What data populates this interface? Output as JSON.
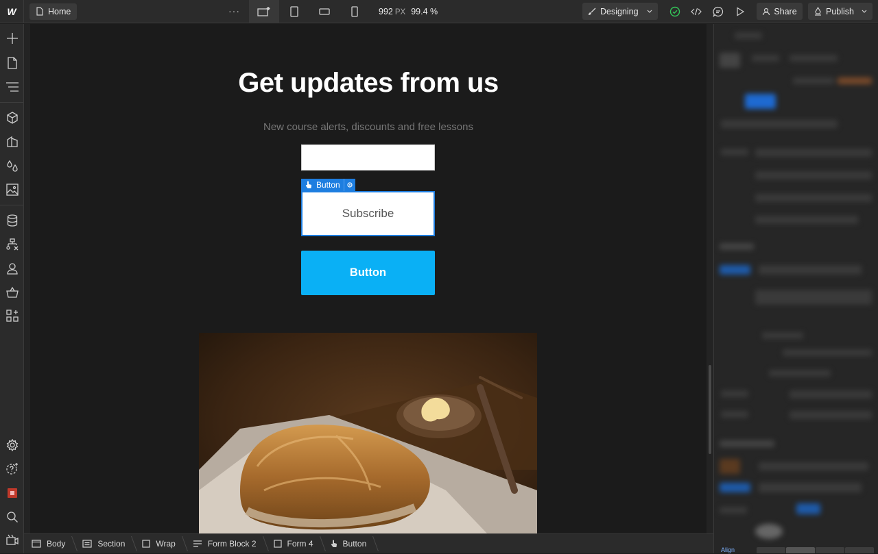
{
  "topbar": {
    "page_label": "Home",
    "more_label": "···",
    "width_value": "992",
    "width_unit": "PX",
    "zoom_value": "99.4 %",
    "mode_label": "Designing",
    "share_label": "Share",
    "publish_label": "Publish"
  },
  "canvas": {
    "heading": "Get updates from us",
    "subheading": "New course alerts, discounts and free lessons",
    "selected_tag": "Button",
    "subscribe_label": "Subscribe",
    "cta_label": "Button"
  },
  "breadcrumbs": [
    {
      "label": "Body",
      "icon": "body-icon"
    },
    {
      "label": "Section",
      "icon": "section-icon"
    },
    {
      "label": "Wrap",
      "icon": "div-block-icon"
    },
    {
      "label": "Form Block 2",
      "icon": "form-block-icon"
    },
    {
      "label": "Form 4",
      "icon": "form-icon"
    },
    {
      "label": "Button",
      "icon": "pointer-hand-icon"
    }
  ],
  "right_panel": {
    "bottom_label": "Align"
  },
  "colors": {
    "accent_blue": "#1e7ee0",
    "cta_cyan": "#0ab0f5",
    "status_green": "#34c759"
  }
}
